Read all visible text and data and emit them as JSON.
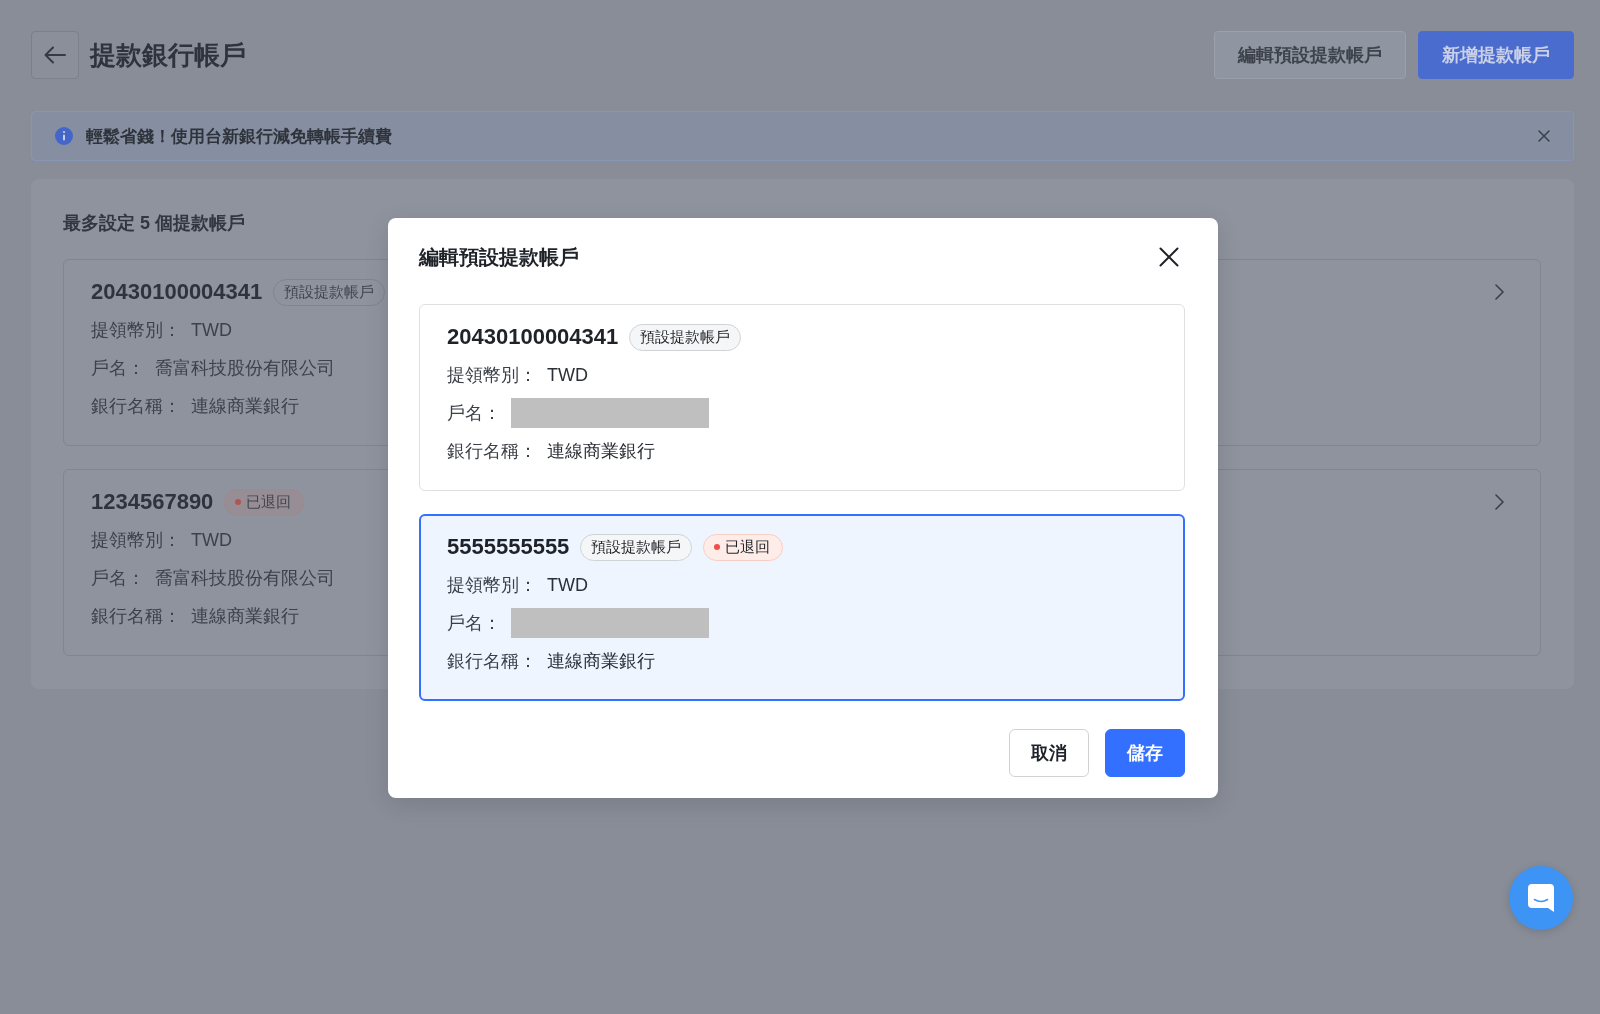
{
  "header": {
    "title": "提款銀行帳戶",
    "actions": [
      {
        "label": "編輯預設提款帳戶",
        "kind": "edit"
      },
      {
        "label": "新增提款帳戶",
        "kind": "add"
      }
    ]
  },
  "notice": {
    "text": "輕鬆省錢！使用台新銀行減免轉帳手續費"
  },
  "account_list": {
    "heading": "最多設定 5 個提款帳戶",
    "accounts": [
      {
        "number": "20430100004341",
        "tags": [
          {
            "label": "預設提款帳戶",
            "kind": "default"
          }
        ],
        "fields": [
          {
            "label": "提領幣別：",
            "value": "TWD",
            "kind": "text"
          },
          {
            "label": "戶名：",
            "value": "喬富科技股份有限公司",
            "kind": "text"
          },
          {
            "label": "銀行名稱：",
            "value": "連線商業銀行",
            "kind": "text"
          }
        ]
      },
      {
        "number": "1234567890",
        "tags": [
          {
            "label": "已退回",
            "kind": "returned"
          }
        ],
        "fields": [
          {
            "label": "提領幣別：",
            "value": "TWD",
            "kind": "text"
          },
          {
            "label": "戶名：",
            "value": "喬富科技股份有限公司",
            "kind": "text"
          },
          {
            "label": "銀行名稱：",
            "value": "連線商業銀行",
            "kind": "text"
          }
        ]
      }
    ]
  },
  "dialog": {
    "title": "編輯預設提款帳戶",
    "options": [
      {
        "number": "20430100004341",
        "selected": false,
        "tags": [
          {
            "label": "預設提款帳戶",
            "kind": "default"
          }
        ],
        "fields": [
          {
            "label": "提領幣別：",
            "value": "TWD",
            "kind": "text"
          },
          {
            "label": "戶名：",
            "kind": "redacted"
          },
          {
            "label": "銀行名稱：",
            "value": "連線商業銀行",
            "kind": "text"
          }
        ]
      },
      {
        "number": "5555555555",
        "selected": true,
        "tags": [
          {
            "label": "預設提款帳戶",
            "kind": "default"
          },
          {
            "label": "已退回",
            "kind": "returned"
          }
        ],
        "fields": [
          {
            "label": "提領幣別：",
            "value": "TWD",
            "kind": "text"
          },
          {
            "label": "戶名：",
            "kind": "redacted"
          },
          {
            "label": "銀行名稱：",
            "value": "連線商業銀行",
            "kind": "text"
          }
        ]
      }
    ],
    "buttons": [
      {
        "label": "取消",
        "kind": "cancel"
      },
      {
        "label": "儲存",
        "kind": "save"
      }
    ]
  }
}
